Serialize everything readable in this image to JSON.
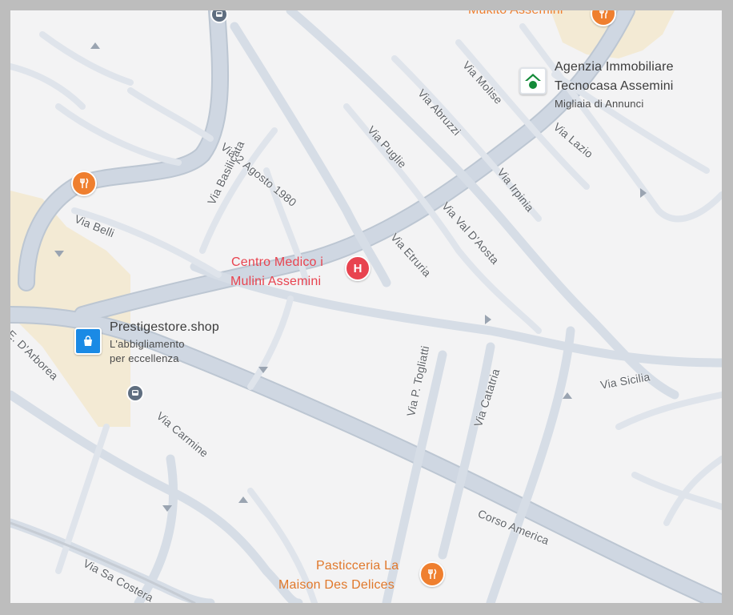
{
  "colors": {
    "road": "#cfd7e2",
    "road_edge": "#bcc6d2",
    "land": "#f3f3f4",
    "sand": "#f3ead4",
    "food": "#ef7f2f",
    "medical": "#e8434f",
    "shop": "#1a8ae5",
    "realestate": "#138a38"
  },
  "roads": [
    {
      "id": "via-2-agosto-1980",
      "label": "Via 2 Agosto 1980"
    },
    {
      "id": "via-basilicata",
      "label": "Via Basilicata"
    },
    {
      "id": "via-belli",
      "label": "Via Belli"
    },
    {
      "id": "via-puglie",
      "label": "Via Puglie"
    },
    {
      "id": "via-abruzzi",
      "label": "Via Abruzzi"
    },
    {
      "id": "via-molise",
      "label": "Via Molise"
    },
    {
      "id": "via-lazio",
      "label": "Via Lazio"
    },
    {
      "id": "via-irpinia",
      "label": "Via Irpinia"
    },
    {
      "id": "via-val-daosta",
      "label": "Via Val D'Aosta"
    },
    {
      "id": "via-etruria",
      "label": "Via Etruria"
    },
    {
      "id": "via-sicilia",
      "label": "Via Sicilia"
    },
    {
      "id": "via-p-togliatti",
      "label": "Via P. Togliatti"
    },
    {
      "id": "via-catatria",
      "label": "Via Catatria"
    },
    {
      "id": "e-darborea",
      "label": "E. D'Arborea"
    },
    {
      "id": "via-carmine",
      "label": "Via Carmine"
    },
    {
      "id": "corso-america",
      "label": "Corso America"
    },
    {
      "id": "via-sa-costera",
      "label": "Via Sa Costera"
    }
  ],
  "pois": {
    "mukito": {
      "title": "Mukito Assemini",
      "icon": "restaurant-icon"
    },
    "tecnocasa": {
      "title_line1": "Agenzia Immobiliare",
      "title_line2": "Tecnocasa Assemini",
      "sub": "Migliaia di Annunci",
      "icon": "real-estate-icon"
    },
    "centro_medico": {
      "title_line1": "Centro Medico i",
      "title_line2": "Mulini Assemini",
      "icon": "hospital-icon"
    },
    "prestigestore": {
      "title": "Prestigestore.shop",
      "sub_line1": "L'abbigliamento",
      "sub_line2": "per eccellenza",
      "icon": "shopping-bag-icon"
    },
    "pasticceria": {
      "title_line1": "Pasticceria La",
      "title_line2": "Maison Des Delices",
      "icon": "restaurant-icon"
    },
    "restaurant_west": {
      "icon": "restaurant-icon"
    }
  },
  "transit": [
    {
      "id": "bus-stop-top",
      "icon": "bus-stop-icon"
    },
    {
      "id": "bus-stop-mid",
      "icon": "bus-stop-icon"
    }
  ]
}
